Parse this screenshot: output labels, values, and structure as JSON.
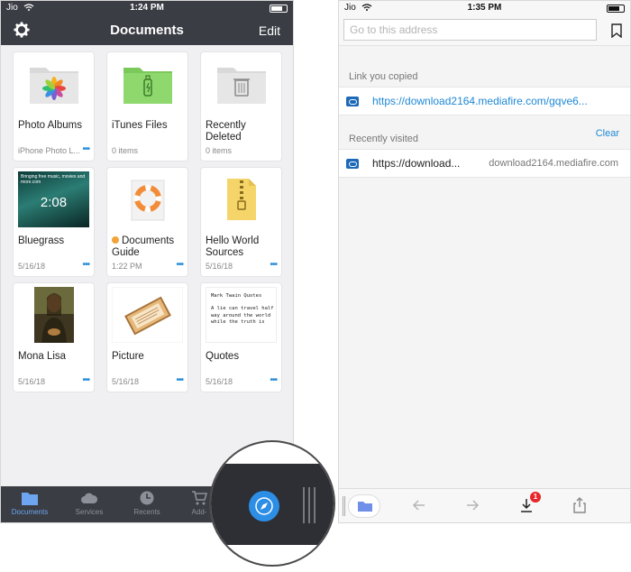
{
  "left_phone": {
    "status": {
      "carrier": "Jio",
      "time": "1:24 PM"
    },
    "header": {
      "title": "Documents",
      "edit_label": "Edit"
    },
    "items": [
      {
        "name": "Photo Albums",
        "meta": "iPhone Photo L...",
        "icon": "photos-folder"
      },
      {
        "name": "iTunes Files",
        "meta": "0 items",
        "icon": "usb-folder"
      },
      {
        "name": "Recently Deleted",
        "meta": "0 items",
        "icon": "trash-folder"
      },
      {
        "name": "Bluegrass",
        "meta": "5/16/18",
        "thumb_text": "2:08",
        "thumb_caption": "Bringing free music, movies and more.com"
      },
      {
        "name": "Documents Guide",
        "meta": "1:22 PM",
        "icon": "lifebuoy"
      },
      {
        "name": "Hello World Sources",
        "meta": "5/16/18",
        "icon": "zip-file"
      },
      {
        "name": "Mona Lisa",
        "meta": "5/16/18",
        "icon": "painting"
      },
      {
        "name": "Picture",
        "meta": "5/16/18",
        "icon": "picture-frame"
      },
      {
        "name": "Quotes",
        "meta": "5/16/18",
        "thumb_text": "Mark Twain Quotes",
        "thumb_body": "A lie can travel half way around the world while the truth is"
      }
    ],
    "more_label": "•••",
    "tabs": [
      {
        "label": "Documents"
      },
      {
        "label": "Services"
      },
      {
        "label": "Recents"
      },
      {
        "label": "Add-"
      }
    ]
  },
  "right_phone": {
    "status": {
      "carrier": "Jio",
      "time": "1:35 PM"
    },
    "address_placeholder": "Go to this address",
    "copied_header": "Link you copied",
    "copied_link": "https://download2164.mediafire.com/gqve6...",
    "recent_header": "Recently visited",
    "clear_label": "Clear",
    "recent_item": {
      "title": "https://download...",
      "domain": "download2164.mediafire.com"
    },
    "download_badge": "1"
  },
  "colors": {
    "dark_bar": "#3a3d44",
    "accent_blue": "#1e88d6",
    "folder_gray": "#d9d9d9",
    "folder_green": "#8ed86d",
    "badge_red": "#e8262b"
  }
}
